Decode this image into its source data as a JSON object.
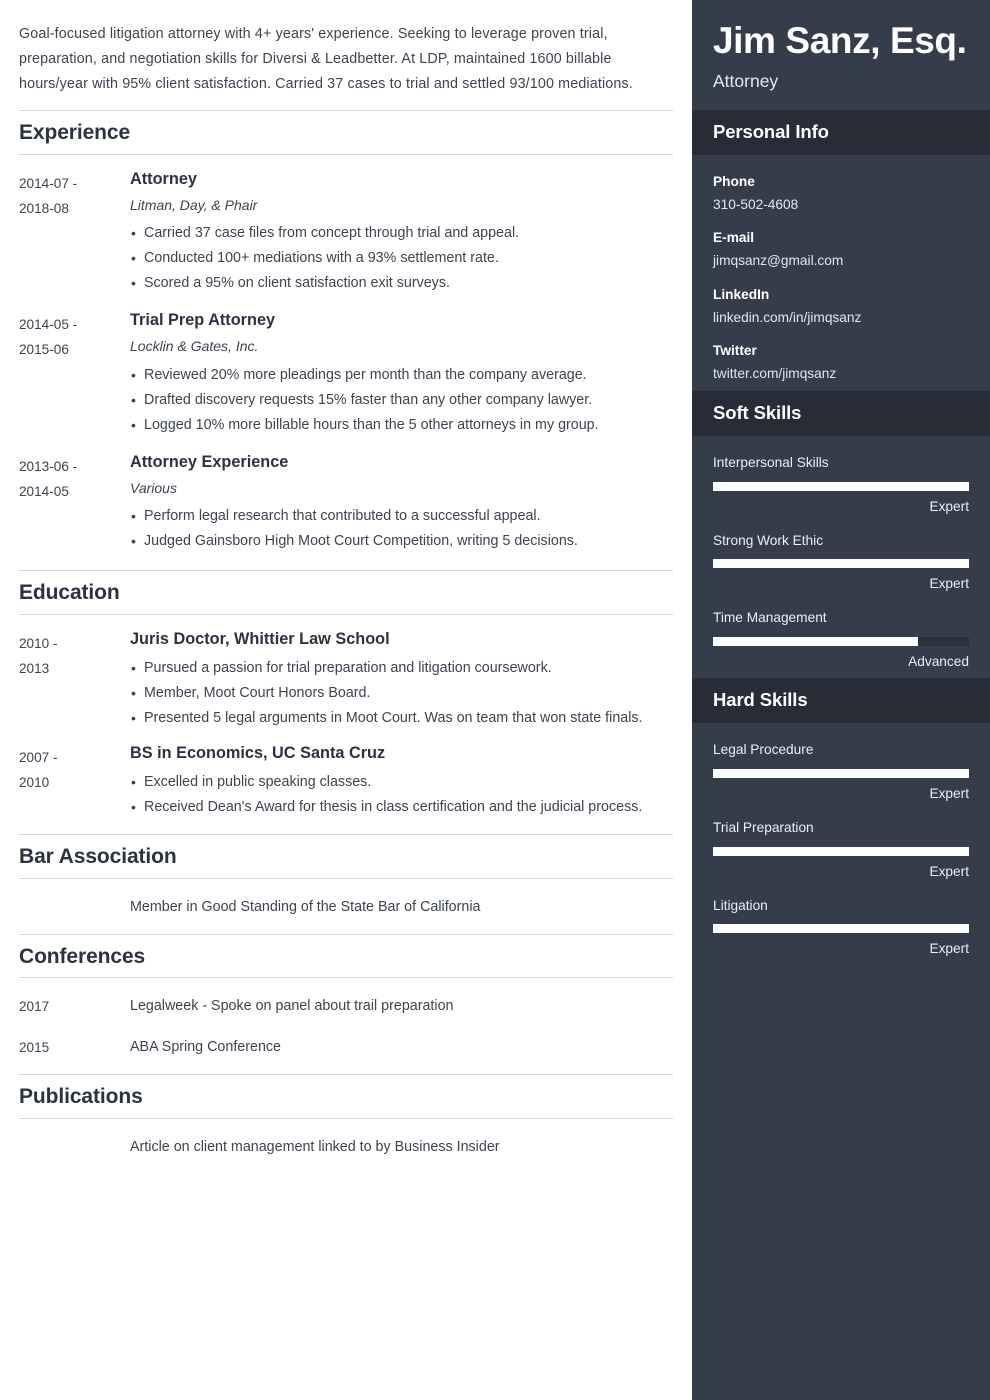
{
  "summary": "Goal-focused litigation attorney with 4+ years' experience. Seeking to leverage proven trial, preparation, and negotiation skills for Diversi & Leadbetter. At LDP, maintained 1600 billable hours/year with 95% client satisfaction. Carried 37 cases to trial and settled 93/100 mediations.",
  "sections": {
    "experience": {
      "title": "Experience",
      "entries": [
        {
          "date_start": "2014-07 -",
          "date_end": "2018-08",
          "title": "Attorney",
          "org": "Litman, Day, & Phair",
          "bullets": [
            "Carried 37 case files from concept through trial and appeal.",
            "Conducted 100+ mediations with a 93% settlement rate.",
            "Scored a 95% on client satisfaction exit surveys."
          ]
        },
        {
          "date_start": "2014-05 -",
          "date_end": "2015-06",
          "title": "Trial Prep Attorney",
          "org": "Locklin & Gates, Inc.",
          "bullets": [
            "Reviewed 20% more pleadings per month than the company average.",
            "Drafted discovery requests 15% faster than any other company lawyer.",
            "Logged 10% more billable hours than the 5 other attorneys in my group."
          ]
        },
        {
          "date_start": "2013-06 -",
          "date_end": "2014-05",
          "title": "Attorney Experience",
          "org": "Various",
          "bullets": [
            "Perform legal research that contributed to a successful appeal.",
            "Judged Gainsboro High Moot Court Competition, writing 5 decisions."
          ]
        }
      ]
    },
    "education": {
      "title": "Education",
      "entries": [
        {
          "date_start": "2010 -",
          "date_end": "2013",
          "title": "Juris Doctor, Whittier Law School",
          "bullets": [
            "Pursued a passion for trial preparation and litigation coursework.",
            "Member, Moot Court Honors Board.",
            "Presented 5 legal arguments in Moot Court. Was on team that won state finals."
          ]
        },
        {
          "date_start": "2007 -",
          "date_end": "2010",
          "title": "BS in Economics, UC Santa Cruz",
          "bullets": [
            "Excelled in public speaking classes.",
            "Received Dean's Award for thesis in class certification and the judicial process."
          ]
        }
      ]
    },
    "bar_association": {
      "title": "Bar Association",
      "rows": [
        {
          "date": "",
          "text": "Member in Good Standing of the State Bar of California"
        }
      ]
    },
    "conferences": {
      "title": "Conferences",
      "rows": [
        {
          "date": "2017",
          "text": "Legalweek - Spoke on panel about trail preparation"
        },
        {
          "date": "2015",
          "text": "ABA Spring Conference"
        }
      ]
    },
    "publications": {
      "title": "Publications",
      "rows": [
        {
          "date": "",
          "text": "Article on client management linked to by Business Insider"
        }
      ]
    }
  },
  "sidebar": {
    "name": "Jim Sanz, Esq.",
    "role": "Attorney",
    "personal_info": {
      "title": "Personal Info",
      "items": [
        {
          "label": "Phone",
          "value": "310-502-4608"
        },
        {
          "label": "E-mail",
          "value": "jimqsanz@gmail.com"
        },
        {
          "label": "LinkedIn",
          "value": "linkedin.com/in/jimqsanz"
        },
        {
          "label": "Twitter",
          "value": "twitter.com/jimqsanz"
        }
      ]
    },
    "soft_skills": {
      "title": "Soft Skills",
      "items": [
        {
          "name": "Interpersonal Skills",
          "level": "Expert",
          "percent": 100
        },
        {
          "name": "Strong Work Ethic",
          "level": "Expert",
          "percent": 100
        },
        {
          "name": "Time Management",
          "level": "Advanced",
          "percent": 80
        }
      ]
    },
    "hard_skills": {
      "title": "Hard Skills",
      "items": [
        {
          "name": "Legal Procedure",
          "level": "Expert",
          "percent": 100
        },
        {
          "name": "Trial Preparation",
          "level": "Expert",
          "percent": 100
        },
        {
          "name": "Litigation",
          "level": "Expert",
          "percent": 100
        }
      ]
    }
  },
  "colors": {
    "sidebar_bg": "#363d4a",
    "sidebar_band_bg": "#272c36",
    "heading_text": "#2c3340",
    "body_text": "#3c4450",
    "rule": "#d8d9dc",
    "skill_fill": "#ffffff",
    "skill_track": "#2b313c"
  }
}
